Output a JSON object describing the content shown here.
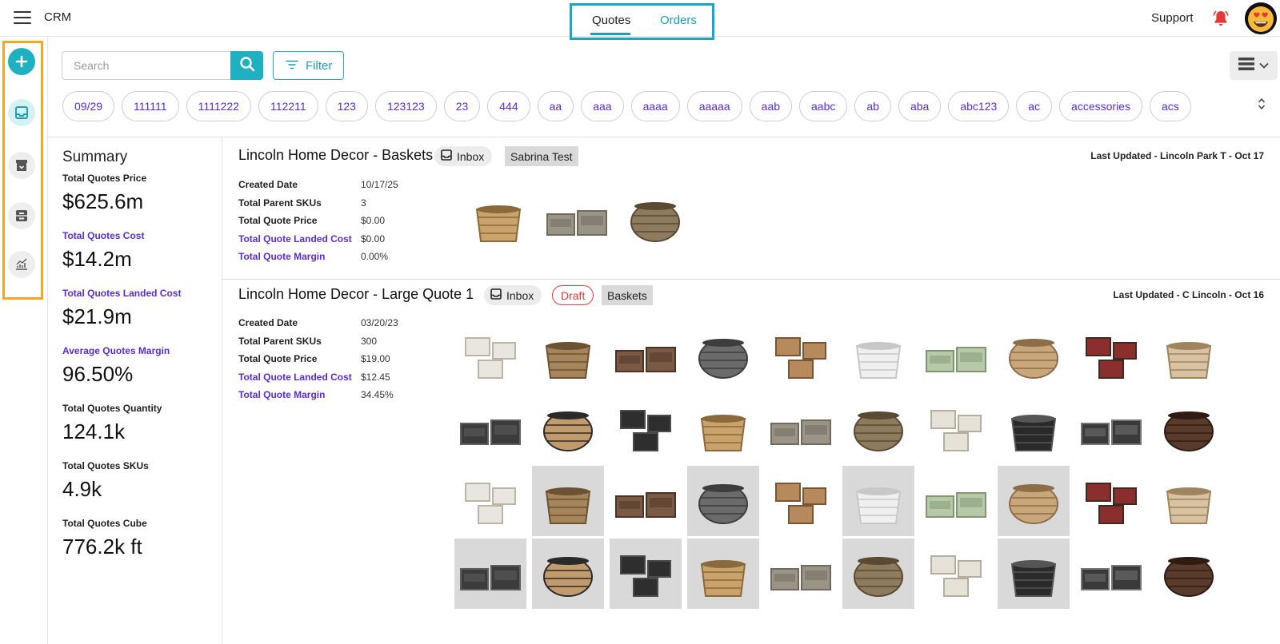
{
  "header": {
    "app_name": "CRM",
    "tabs": [
      {
        "label": "Quotes",
        "active": true
      },
      {
        "label": "Orders",
        "active": false
      }
    ],
    "support_label": "Support"
  },
  "icons": {
    "menu": "hamburger-icon",
    "notifications": "bell-icon",
    "avatar": "heart-eyes-emoji-avatar",
    "rail": [
      "add-icon",
      "inbox-icon",
      "archive-icon",
      "tray-icon",
      "chart-icon"
    ],
    "search": "search-icon",
    "filter": "filter-icon",
    "view": "list-view-icon"
  },
  "colors": {
    "accent": "#1fb0c2",
    "link_purple": "#5a2bd9",
    "highlight_blue": "#1aa7c4",
    "highlight_orange": "#f5a623",
    "bell_red": "#e53935",
    "draft_red": "#e53935"
  },
  "toolbar": {
    "search_placeholder": "Search",
    "filter_label": "Filter"
  },
  "tags": [
    "09/29",
    "111111",
    "1111222",
    "112211",
    "123",
    "123123",
    "23",
    "444",
    "aa",
    "aaa",
    "aaaa",
    "aaaaa",
    "aab",
    "aabc",
    "ab",
    "aba",
    "abc123",
    "ac",
    "accessories",
    "acs"
  ],
  "summary": {
    "title": "Summary",
    "metrics": [
      {
        "label": "Total Quotes Price",
        "value": "$625.6m",
        "purple": false
      },
      {
        "label": "Total Quotes Cost",
        "value": "$14.2m",
        "purple": true
      },
      {
        "label": "Total Quotes Landed Cost",
        "value": "$21.9m",
        "purple": true
      },
      {
        "label": "Average Quotes Margin",
        "value": "96.50%",
        "purple": true
      },
      {
        "label": "Total Quotes Quantity",
        "value": "124.1k",
        "purple": false
      },
      {
        "label": "Total Quotes SKUs",
        "value": "4.9k",
        "purple": false
      },
      {
        "label": "Total Quotes Cube",
        "value": "776.2k ft",
        "purple": false
      }
    ]
  },
  "quotes": [
    {
      "title": "Lincoln Home Decor - Baskets",
      "status": "Inbox",
      "draft": "",
      "tag": "Sabrina Test",
      "updated": "Last Updated - Lincoln Park T - Oct 17",
      "details": [
        {
          "label": "Created Date",
          "value": "10/17/25"
        },
        {
          "label": "Total Parent SKUs",
          "value": "3"
        },
        {
          "label": "Total Quote Price",
          "value": "$0.00"
        },
        {
          "label": "Total Quote Landed Cost",
          "value": "$0.00"
        },
        {
          "label": "Total Quote Margin",
          "value": "0.00%"
        }
      ],
      "product_thumbnails": 3
    },
    {
      "title": "Lincoln Home Decor - Large Quote 1",
      "status": "Inbox",
      "draft": "Draft",
      "tag": "Baskets",
      "updated": "Last Updated - C Lincoln - Oct 16",
      "details": [
        {
          "label": "Created Date",
          "value": "03/20/23"
        },
        {
          "label": "Total Parent SKUs",
          "value": "300"
        },
        {
          "label": "Total Quote Price",
          "value": "$19.00"
        },
        {
          "label": "Total Quote Landed Cost",
          "value": "$12.45"
        },
        {
          "label": "Total Quote Margin",
          "value": "34.45%"
        }
      ],
      "product_thumbnails": 40
    }
  ]
}
